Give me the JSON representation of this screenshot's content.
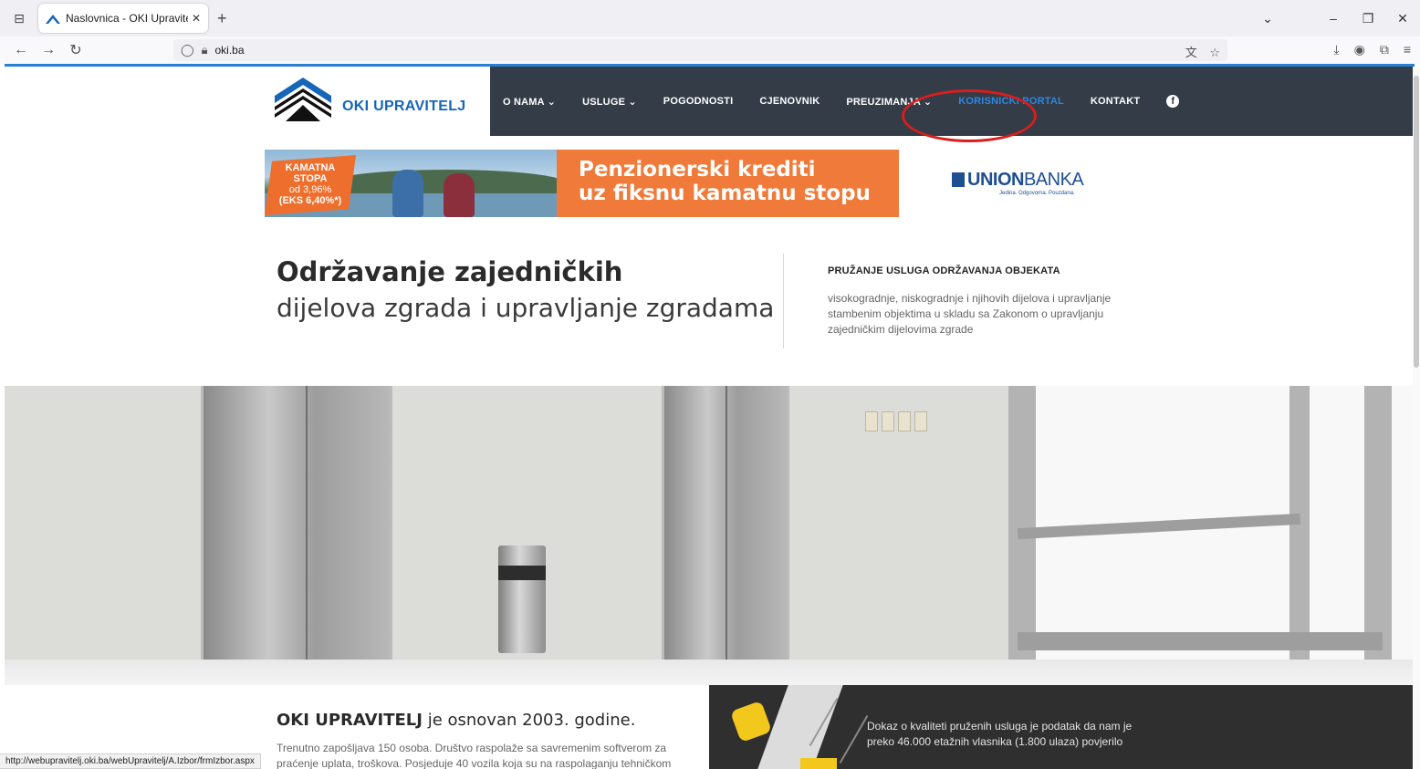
{
  "browser": {
    "tab_title": "Naslovnica - OKI Upravitelj - OI",
    "url": "oki.ba",
    "status_url": "http://webupravitelj.oki.ba/webUpravitelj/A.Izbor/frmIzbor.aspx"
  },
  "site": {
    "logo_text": "OKI UPRAVITELJ",
    "menu": [
      {
        "label": "O NAMA ⌄"
      },
      {
        "label": "USLUGE ⌄"
      },
      {
        "label": "POGODNOSTI"
      },
      {
        "label": "CJENOVNIK"
      },
      {
        "label": "PREUZIMANJA ⌄"
      },
      {
        "label": "KORISNIČKI PORTAL"
      },
      {
        "label": "KONTAKT"
      }
    ],
    "accent_color": "#2f86e0",
    "menu_bg": "#333c47"
  },
  "banner": {
    "rate_line1": "KAMATNA",
    "rate_line2": "STOPA",
    "rate_line3": "od 3,96%",
    "rate_line4": "(EKS 6,40%*)",
    "headline1": "Penzionerski krediti",
    "headline2": "uz fiksnu kamatnu stopu",
    "bank_bold": "UNION",
    "bank_light": "BANKA",
    "bank_tagline": "Jedina. Odgovorna. Pouzdana."
  },
  "intro": {
    "title": "Održavanje zajedničkih",
    "subtitle": "dijelova zgrada i upravljanje zgradama"
  },
  "services": {
    "heading": "PRUŽANJE USLUGA ODRŽAVANJA OBJEKATA",
    "text": "visokogradnje, niskogradnje i njihovih dijelova i upravljanje stambenim objektima u skladu sa Zakonom o upravljanju zajedničkim dijelovima zgrade"
  },
  "about": {
    "title_bold": "OKI UPRAVITELJ",
    "title_rest": " je osnovan 2003. godine.",
    "text": "Trenutno zapošljava 150 osoba. Društvo raspolaže sa savremenim softverom za praćenje uplata, troškova. Posjeduje 40 vozila koja su na raspolaganju tehničkom"
  },
  "quality": {
    "text": "Dokaz o kvaliteti pruženih usluga je podatak da nam je preko 46.000 etažnih vlasnika (1.800 ulaza) povjerilo"
  }
}
